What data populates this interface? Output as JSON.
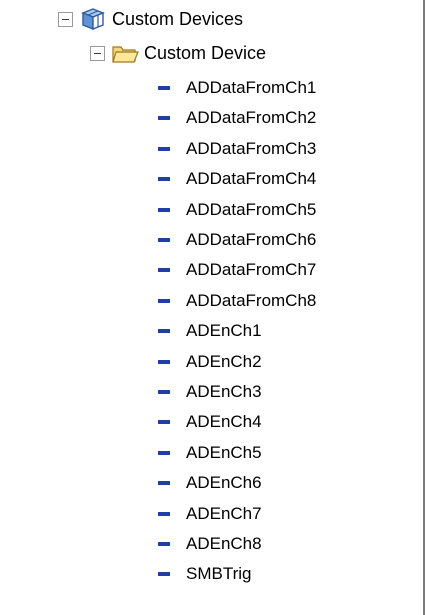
{
  "tree": {
    "root": {
      "label": "Custom Devices",
      "icon": "custom-devices-cube-icon",
      "expanded": true
    },
    "folder": {
      "label": "Custom Device",
      "icon": "folder-open-icon",
      "expanded": true
    },
    "leaf_icon": "channel-dash-icon",
    "leaf_color": "#1f3ea8",
    "channels": [
      "ADDataFromCh1",
      "ADDataFromCh2",
      "ADDataFromCh3",
      "ADDataFromCh4",
      "ADDataFromCh5",
      "ADDataFromCh6",
      "ADDataFromCh7",
      "ADDataFromCh8",
      "ADEnCh1",
      "ADEnCh2",
      "ADEnCh3",
      "ADEnCh4",
      "ADEnCh5",
      "ADEnCh6",
      "ADEnCh7",
      "ADEnCh8",
      "SMBTrig"
    ]
  }
}
